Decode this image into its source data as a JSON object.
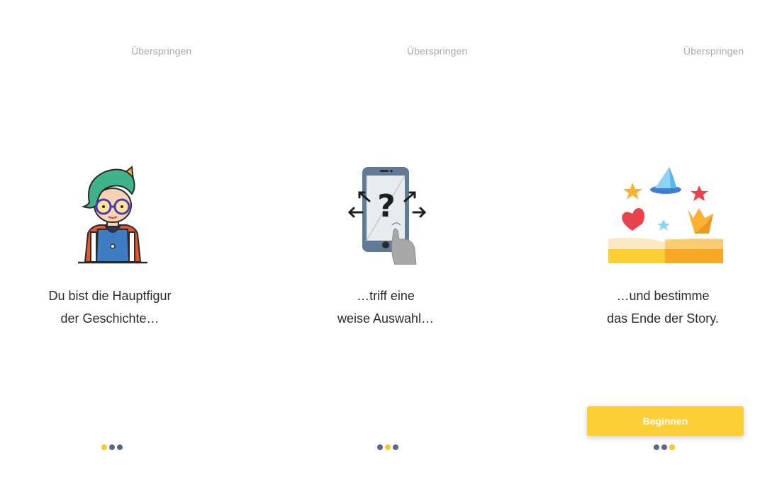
{
  "screens": [
    {
      "skip_label": "Überspringen",
      "caption_line1": "Du bist die Hauptfigur",
      "caption_line2": "der Geschichte…",
      "illustration_icon": "hero-character-icon",
      "dots_active_index": 0
    },
    {
      "skip_label": "Überspringen",
      "caption_line1": "…triff eine",
      "caption_line2": "weise Auswahl…",
      "illustration_icon": "phone-choice-icon",
      "dots_active_index": 1
    },
    {
      "skip_label": "Überspringen",
      "caption_line1": "…und bestimme",
      "caption_line2": "das Ende der Story.",
      "illustration_icon": "magic-book-icon",
      "dots_active_index": 2,
      "start_button_label": "Beginnen"
    }
  ],
  "colors": {
    "accent": "#fccf36",
    "dot_active": "#f7c72f",
    "dot_inactive": "#5b6b7d",
    "skip_text": "#a9a9a9",
    "caption_text": "#2b2b2b"
  }
}
